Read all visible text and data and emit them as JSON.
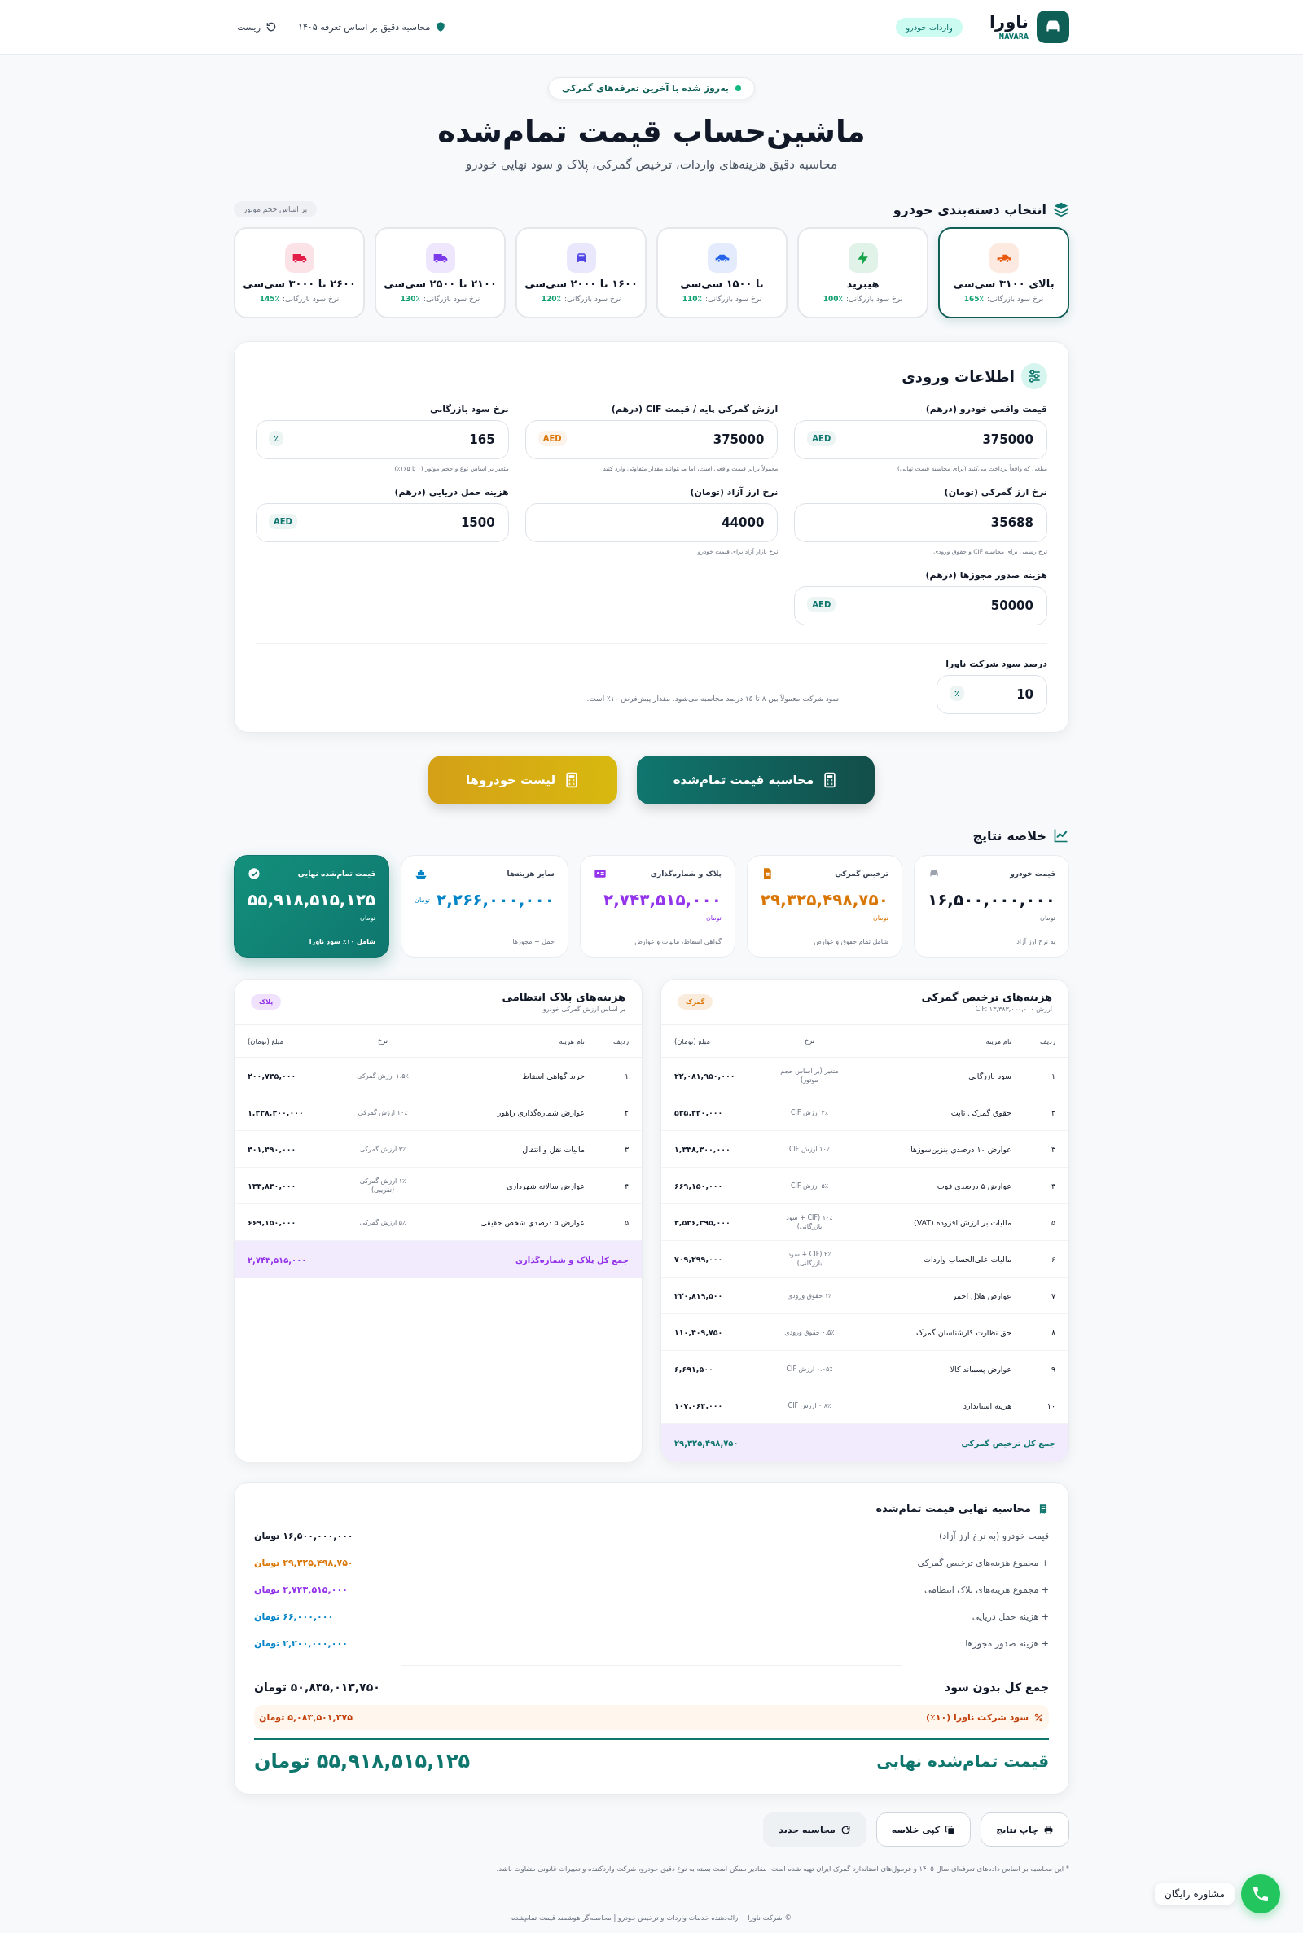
{
  "header": {
    "brand": "ناورا",
    "brand_latin": "NAVARA",
    "badge": "واردات خودرو",
    "info": "محاسبه دقیق بر اساس تعرفه ۱۴۰۵",
    "reset": "ریست"
  },
  "hero": {
    "badge": "به‌روز شده با آخرین تعرفه‌های گمرکی",
    "title": "ماشین‌حساب قیمت تمام‌شده",
    "subtitle": "محاسبه دقیق هزینه‌های واردات، ترخیص گمرکی، پلاک و سود نهایی خودرو"
  },
  "categories": {
    "title": "انتخاب دسته‌بندی خودرو",
    "hint": "بر اساس حجم موتور",
    "items": [
      {
        "name": "بالای ۳۱۰۰ سی‌سی",
        "rate_label": "نرخ سود بازرگانی:",
        "rate": "165٪",
        "color": "#ea580c",
        "selected": true
      },
      {
        "name": "هیبرید",
        "rate_label": "نرخ سود بازرگانی:",
        "rate": "100٪",
        "color": "#16a34a",
        "selected": false
      },
      {
        "name": "تا ۱۵۰۰ سی‌سی",
        "rate_label": "نرخ سود بازرگانی:",
        "rate": "110٪",
        "color": "#2563eb",
        "selected": false
      },
      {
        "name": "۱۶۰۰ تا ۲۰۰۰ سی‌سی",
        "rate_label": "نرخ سود بازرگانی:",
        "rate": "120٪",
        "color": "#4f46e5",
        "selected": false
      },
      {
        "name": "۲۱۰۰ تا ۲۵۰۰ سی‌سی",
        "rate_label": "نرخ سود بازرگانی:",
        "rate": "130٪",
        "color": "#7c3aed",
        "selected": false
      },
      {
        "name": "۲۶۰۰ تا ۳۰۰۰ سی‌سی",
        "rate_label": "نرخ سود بازرگانی:",
        "rate": "145٪",
        "color": "#e11d48",
        "selected": false
      }
    ]
  },
  "inputs": {
    "title": "اطلاعات ورودی",
    "fields": [
      {
        "label": "قیمت واقعی خودرو (درهم)",
        "value": "375000",
        "unit": "AED",
        "color": "#0f766e",
        "hint": "مبلغی که واقعاً پرداخت می‌کنید (برای محاسبه قیمت نهایی)"
      },
      {
        "label": "ارزش گمرکی پایه / قیمت CIF (درهم)",
        "value": "375000",
        "unit": "AED",
        "color": "#d97706",
        "hint": "معمولاً برابر قیمت واقعی است، اما می‌توانید مقدار متفاوتی وارد کنید"
      },
      {
        "label": "نرخ سود بازرگانی",
        "value": "165",
        "unit": "٪",
        "hint": "متغیر بر اساس نوع و حجم موتور (۰ تا ۱۶۵٪)"
      },
      {
        "label": "نرخ ارز گمرکی (تومان)",
        "value": "35688",
        "hint": "نرخ رسمی برای محاسبه CIF و حقوق ورودی"
      },
      {
        "label": "نرخ ارز آزاد (تومان)",
        "value": "44000",
        "hint": "نرخ بازار آزاد برای قیمت خودرو"
      },
      {
        "label": "هزینه حمل دریایی (درهم)",
        "value": "1500",
        "unit": "AED",
        "color": "#0f766e"
      },
      {
        "label": "هزینه صدور مجوزها (درهم)",
        "value": "50000",
        "unit": "AED",
        "color": "#0f766e"
      }
    ],
    "profit": {
      "label": "درصد سود شرکت ناورا",
      "value": "10",
      "unit": "٪",
      "note": "سود شرکت معمولاً بین ۸ تا ۱۵ درصد محاسبه می‌شود. مقدار پیش‌فرض ۱۰٪ است."
    }
  },
  "actions": {
    "calculate": "محاسبه قیمت تمام‌شده",
    "car_list": "لیست خودروها"
  },
  "summary": {
    "title": "خلاصه نتایج",
    "cards": [
      {
        "kind": "plain",
        "label": "قیمت خودرو",
        "value": "۱۶,۵۰۰,۰۰۰,۰۰۰",
        "unit": "تومان",
        "note": "به نرخ ارز آزاد",
        "color": "#111827"
      },
      {
        "kind": "plain",
        "label": "ترخیص گمرکی",
        "value": "۲۹,۳۲۵,۴۹۸,۷۵۰",
        "unit": "تومان",
        "note": "شامل تمام حقوق و عوارض",
        "color": "#d97706"
      },
      {
        "kind": "plain",
        "label": "پلاک و شماره‌گذاری",
        "value": "۲,۷۴۳,۵۱۵,۰۰۰",
        "unit": "تومان",
        "note": "گواهی اسقاط، مالیات و عوارض",
        "color": "#9333ea"
      },
      {
        "kind": "inline",
        "label": "سایر هزینه‌ها",
        "value": "۲,۲۶۶,۰۰۰,۰۰۰",
        "unit": "تومان",
        "note": "حمل + مجوزها",
        "color": "#0284c7"
      },
      {
        "kind": "highlight",
        "label": "قیمت تمام‌شده نهایی",
        "value": "۵۵,۹۱۸,۵۱۵,۱۲۵",
        "unit": "تومان",
        "note": "شامل ۱۰٪ سود ناورا",
        "color": "#ffffff"
      }
    ]
  },
  "tables": [
    {
      "title": "هزینه‌های ترخیص گمرکی",
      "subtitle": "ارزش CIF: ۱۳,۳۸۳,۰۰۰,۰۰۰",
      "badge": "گمرک",
      "color": "#d97706",
      "columns": [
        "ردیف",
        "نام هزینه",
        "نرخ",
        "مبلغ (تومان)"
      ],
      "rows": [
        [
          "۱",
          "سود بازرگانی",
          "متغیر (بر اساس حجم موتور)",
          "۲۲,۰۸۱,۹۵۰,۰۰۰"
        ],
        [
          "۲",
          "حقوق گمرکی ثابت",
          "۴٪ ارزش CIF",
          "۵۳۵,۳۲۰,۰۰۰"
        ],
        [
          "۳",
          "عوارض ۱۰ درصدی بنزین‌سوزها",
          "۱۰٪ ارزش CIF",
          "۱,۳۳۸,۳۰۰,۰۰۰"
        ],
        [
          "۴",
          "عوارض ۵ درصدی فوب",
          "۵٪ ارزش CIF",
          "۶۶۹,۱۵۰,۰۰۰"
        ],
        [
          "۵",
          "مالیات بر ارزش افزوده (VAT)",
          "۱۰٪ (CIF + سود بازرگانی)",
          "۳,۵۴۶,۴۹۵,۰۰۰"
        ],
        [
          "۶",
          "مالیات علی‌الحساب واردات",
          "۲٪ (CIF + سود بازرگانی)",
          "۷۰۹,۲۹۹,۰۰۰"
        ],
        [
          "۷",
          "عوارض هلال احمر",
          "۱٪ حقوق ورودی",
          "۲۲۰,۸۱۹,۵۰۰"
        ],
        [
          "۸",
          "حق نظارت کارشناسان گمرک",
          "۰.۵٪ حقوق ورودی",
          "۱۱۰,۴۰۹,۷۵۰"
        ],
        [
          "۹",
          "عوارض پسماند کالا",
          "۰.۰۵٪ ارزش CIF",
          "۶,۶۹۱,۵۰۰"
        ],
        [
          "۱۰",
          "هزینه استاندارد",
          "۰.۸٪ ارزش CIF",
          "۱۰۷,۰۶۴,۰۰۰"
        ]
      ],
      "total_label": "جمع کل ترخیص گمرکی",
      "total": "۲۹,۳۲۵,۴۹۸,۷۵۰"
    },
    {
      "title": "هزینه‌های پلاک انتظامی",
      "subtitle": "بر اساس ارزش گمرکی خودرو",
      "badge": "پلاک",
      "color": "#9333ea",
      "columns": [
        "ردیف",
        "نام هزینه",
        "نرخ",
        "مبلغ (تومان)"
      ],
      "rows": [
        [
          "۱",
          "خرید گواهی اسقاط",
          "۱.۵٪ ارزش گمرکی",
          "۲۰۰,۷۴۵,۰۰۰"
        ],
        [
          "۲",
          "عوارض شماره‌گذاری راهور",
          "۱۰٪ ارزش گمرکی",
          "۱,۳۳۸,۳۰۰,۰۰۰"
        ],
        [
          "۳",
          "مالیات نقل و انتقال",
          "۳٪ ارزش گمرکی",
          "۴۰۱,۴۹۰,۰۰۰"
        ],
        [
          "۴",
          "عوارض سالانه شهرداری",
          "۱٪ ارزش گمرکی (تقریبی)",
          "۱۳۳,۸۳۰,۰۰۰"
        ],
        [
          "۵",
          "عوارض ۵ درصدی شخص حقیقی",
          "۵٪ ارزش گمرکی",
          "۶۶۹,۱۵۰,۰۰۰"
        ]
      ],
      "total_label": "جمع کل پلاک و شماره‌گذاری",
      "total": "۲,۷۴۳,۵۱۵,۰۰۰"
    }
  ],
  "final": {
    "title": "محاسبه نهایی قیمت تمام‌شده",
    "lines": [
      {
        "label": "قیمت خودرو (به نرخ ارز آزاد)",
        "value": "۱۶,۵۰۰,۰۰۰,۰۰۰ تومان",
        "color": "#111827"
      },
      {
        "label": "+ مجموع هزینه‌های ترخیص گمرکی",
        "value": "۲۹,۳۲۵,۴۹۸,۷۵۰ تومان",
        "color": "#d97706"
      },
      {
        "label": "+ مجموع هزینه‌های پلاک انتظامی",
        "value": "۲,۷۴۳,۵۱۵,۰۰۰ تومان",
        "color": "#9333ea"
      },
      {
        "label": "+ هزینه حمل دریایی",
        "value": "۶۶,۰۰۰,۰۰۰ تومان",
        "color": "#0284c7"
      },
      {
        "label": "+ هزینه صدور مجوزها",
        "value": "۲,۲۰۰,۰۰۰,۰۰۰ تومان",
        "color": "#0284c7"
      }
    ],
    "subtotal_label": "جمع کل بدون سود",
    "subtotal": "۵۰,۸۳۵,۰۱۳,۷۵۰ تومان",
    "profit_label": "سود شرکت ناورا (۱۰٪)",
    "profit": "۵,۰۸۳,۵۰۱,۳۷۵ تومان",
    "total_label": "قیمت تمام‌شده نهایی",
    "total": "۵۵,۹۱۸,۵۱۵,۱۲۵ تومان"
  },
  "buttons": [
    {
      "label": "چاپ نتایج",
      "kind": "outline"
    },
    {
      "label": "کپی خلاصه",
      "kind": "outline"
    },
    {
      "label": "محاسبه جدید",
      "kind": "muted"
    }
  ],
  "disclaimer": "* این محاسبه بر اساس داده‌های تعرفه‌ای سال ۱۴۰۵ و فرمول‌های استاندارد گمرک ایران تهیه شده است. مقادیر ممکن است بسته به نوع دقیق خودرو، شرکت واردکننده و تغییرات قانونی متفاوت باشد.",
  "footer": "© شرکت ناورا – ارائه‌دهنده خدمات واردات و ترخیص خودرو | محاسبه‌گر هوشمند قیمت تمام‌شده",
  "consult": "مشاوره رایگان"
}
